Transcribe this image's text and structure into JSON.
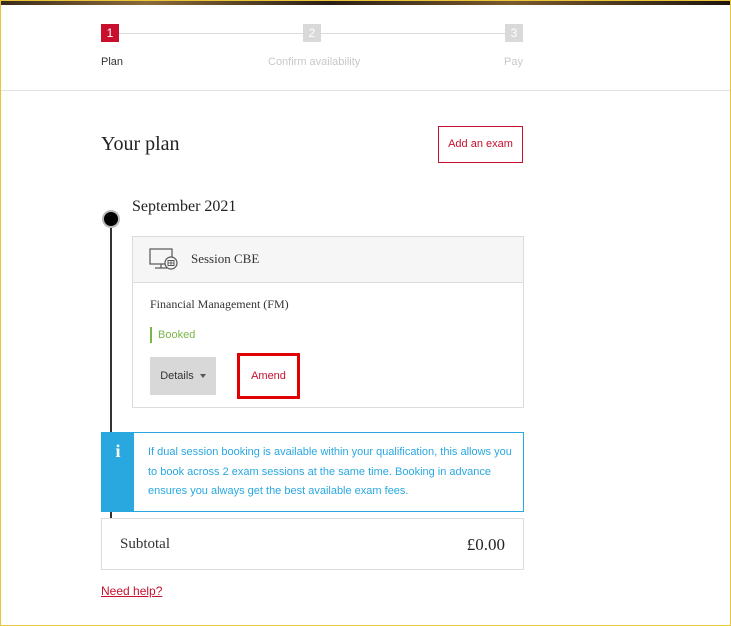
{
  "stepper": {
    "steps": [
      {
        "number": "1",
        "label": "Plan",
        "state": "active"
      },
      {
        "number": "2",
        "label": "Confirm availability",
        "state": "inactive"
      },
      {
        "number": "3",
        "label": "Pay",
        "state": "inactive"
      }
    ]
  },
  "plan": {
    "title": "Your plan",
    "add_exam_label": "Add an exam",
    "month": "September 2021",
    "session": {
      "icon": "computer-exam-icon",
      "title": "Session CBE",
      "exam_name": "Financial Management (FM)",
      "status": "Booked",
      "details_label": "Details",
      "amend_label": "Amend"
    },
    "info": {
      "icon": "info-icon",
      "text": "If dual session booking is available within your qualification, this allows you to book across 2 exam sessions at the same time. Booking in advance ensures you always get the best available exam fees."
    },
    "subtotal": {
      "label": "Subtotal",
      "value": "£0.00"
    },
    "help_link": "Need help?"
  },
  "colors": {
    "brand_red": "#c8102e",
    "info_blue": "#29a8e0",
    "booked_green": "#7ab648",
    "highlight_red": "#e00000"
  }
}
